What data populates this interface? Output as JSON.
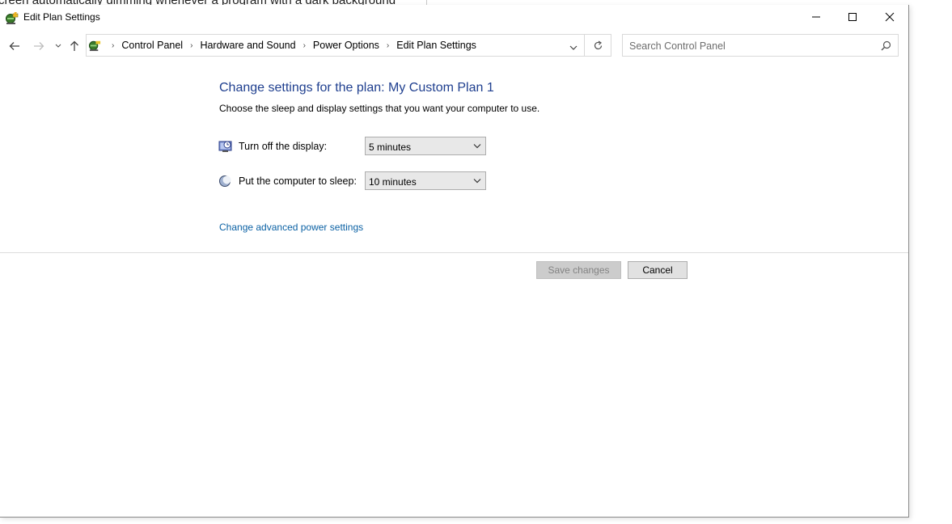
{
  "background": {
    "partial_text": "creen automatically dimming whenever a program with a dark background"
  },
  "window": {
    "title": "Edit Plan Settings",
    "controls": [
      "minimize-icon",
      "maximize-icon",
      "close-icon"
    ]
  },
  "address_bar": {
    "breadcrumbs": [
      "Control Panel",
      "Hardware and Sound",
      "Power Options",
      "Edit Plan Settings"
    ],
    "search_placeholder": "Search Control Panel"
  },
  "main": {
    "title": "Change settings for the plan: My Custom Plan 1",
    "subtitle": "Choose the sleep and display settings that you want your computer to use.",
    "settings": [
      {
        "label": "Turn off the display:",
        "value": "5 minutes",
        "icon": "display-icon"
      },
      {
        "label": "Put the computer to sleep:",
        "value": "10 minutes",
        "icon": "sleep-moon-icon"
      }
    ],
    "advanced_link": "Change advanced power settings"
  },
  "buttons": {
    "save_label": "Save changes",
    "cancel_label": "Cancel"
  },
  "colors": {
    "title_blue": "#1f3f8f",
    "link_blue": "#0b61a4"
  }
}
